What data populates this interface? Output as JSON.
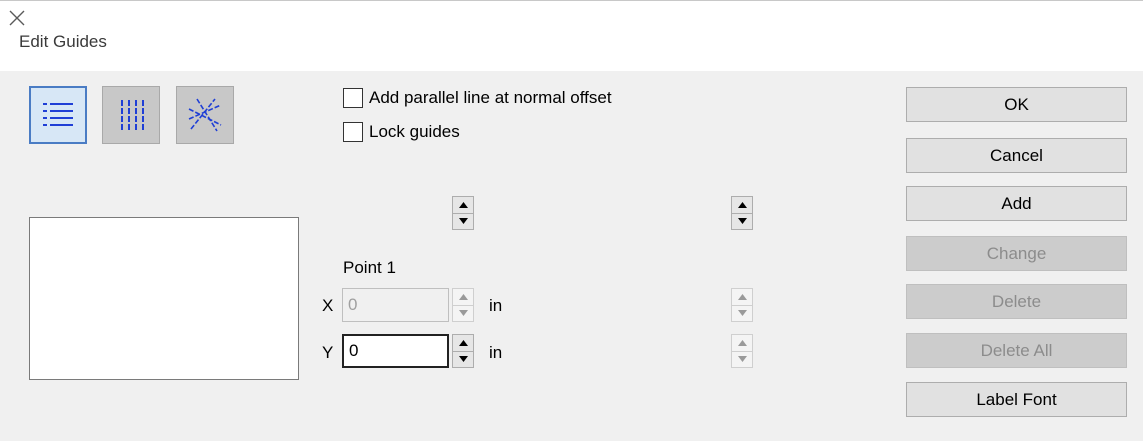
{
  "window": {
    "title": "Edit Guides",
    "close_icon": "close-icon"
  },
  "modes": [
    {
      "name": "horizontal-guides-mode",
      "icon": "horizontal-lines-icon",
      "selected": true
    },
    {
      "name": "vertical-guides-mode",
      "icon": "vertical-lines-icon",
      "selected": false
    },
    {
      "name": "angled-guides-mode",
      "icon": "angled-lines-icon",
      "selected": false
    }
  ],
  "options": {
    "parallel_label": "Add parallel line at normal offset",
    "parallel_checked": false,
    "lock_label": "Lock guides",
    "lock_checked": false
  },
  "point": {
    "heading": "Point 1",
    "x_label": "X",
    "x_value": "0",
    "x_unit": "in",
    "x_enabled": false,
    "y_label": "Y",
    "y_value": "0",
    "y_unit": "in",
    "y_enabled": true
  },
  "buttons": {
    "ok": "OK",
    "cancel": "Cancel",
    "add": "Add",
    "change": "Change",
    "delete": "Delete",
    "delete_all": "Delete All",
    "label_font": "Label Font"
  },
  "colors": {
    "accent": "#4a7cc4",
    "icon_blue": "#1f3fd6",
    "dialog_bg": "#f0f0f0"
  }
}
